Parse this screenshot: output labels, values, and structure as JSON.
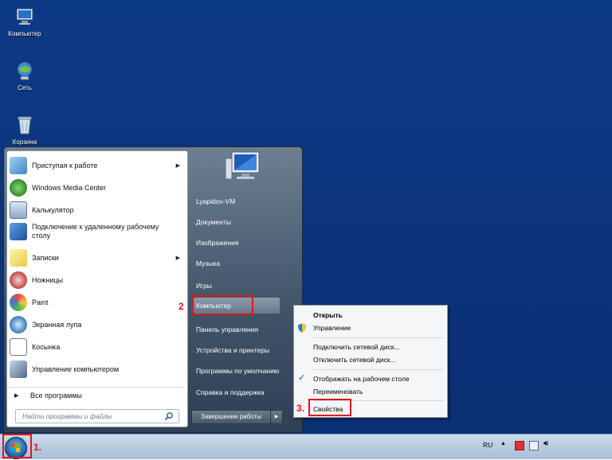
{
  "desktop": {
    "icons": [
      {
        "label": "Компьютер",
        "icon": "computer-icon"
      },
      {
        "label": "Сеть",
        "icon": "network-icon"
      },
      {
        "label": "Корзина",
        "icon": "recycle-bin-icon"
      }
    ]
  },
  "start_menu": {
    "programs": [
      {
        "label": "Приступая к работе",
        "icon": "getting-started-icon",
        "has_arrow": true
      },
      {
        "label": "Windows Media Center",
        "icon": "media-center-icon",
        "has_arrow": false
      },
      {
        "label": "Калькулятор",
        "icon": "calculator-icon",
        "has_arrow": false
      },
      {
        "label": "Подключение к удаленному рабочему столу",
        "icon": "remote-desktop-icon",
        "has_arrow": false
      },
      {
        "label": "Записки",
        "icon": "sticky-notes-icon",
        "has_arrow": true
      },
      {
        "label": "Ножницы",
        "icon": "scissors-icon",
        "has_arrow": false
      },
      {
        "label": "Paint",
        "icon": "paint-icon",
        "has_arrow": false
      },
      {
        "label": "Экранная лупа",
        "icon": "magnifier-icon",
        "has_arrow": false
      },
      {
        "label": "Косынка",
        "icon": "solitaire-icon",
        "has_arrow": false
      },
      {
        "label": "Управление компьютером",
        "icon": "computer-management-icon",
        "has_arrow": false
      }
    ],
    "all_programs_label": "Все программы",
    "search_placeholder": "Найти программы и файлы",
    "right_items": [
      {
        "label": "Lyapidov-VM"
      },
      {
        "label": "Документы"
      },
      {
        "label": "Изображения"
      },
      {
        "label": "Музыка"
      },
      {
        "label": "Игры"
      },
      {
        "label": "Компьютер"
      },
      {
        "label": "Панель управления"
      },
      {
        "label": "Устройства и принтеры"
      },
      {
        "label": "Программы по умолчанию"
      },
      {
        "label": "Справка и поддержка"
      }
    ],
    "shutdown_label": "Завершение работы"
  },
  "context_menu": {
    "items": [
      {
        "label": "Открыть",
        "bold": true
      },
      {
        "label": "Управление",
        "icon": "shield-icon"
      },
      {
        "label": "Подключить сетевой диск..."
      },
      {
        "label": "Отключить сетевой диск..."
      },
      {
        "label": "Отображать на рабочем столе",
        "checked": true
      },
      {
        "label": "Переименовать"
      },
      {
        "label": "Свойства"
      }
    ]
  },
  "annotations": {
    "step1": "1.",
    "step2": "2",
    "step3": "3."
  },
  "taskbar": {
    "language": "RU"
  },
  "colors": {
    "desktop": "#0d3a86",
    "highlight": "#e0161b"
  }
}
